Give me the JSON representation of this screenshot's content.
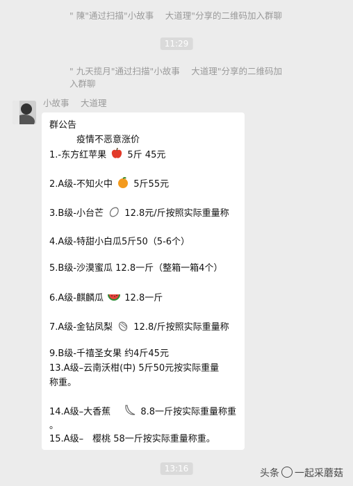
{
  "system_messages": [
    "\" 陳\"通过扫描\"小故事　 大道理\"分享的二维码加入群聊",
    "\" 九天揽月\"通过扫描\"小故事　 大道理\"分享的二维码加",
    "入群聊"
  ],
  "timestamps": [
    "11:29",
    "13:16"
  ],
  "sender_name": "小故事　 大道理",
  "announcement": {
    "lines": [
      "群公告",
      "　　　疫情不恶意涨价",
      "1.-东方红苹果",
      "5斤  45元",
      "2.A级-不知火中",
      "5斤55元",
      "3.B级-小台芒",
      "12.8元/斤按照实际重量称",
      "4.A级-特甜小白瓜5斤50（5-6个）",
      "5.B级-沙漠蜜瓜  12.8一斤（整箱一箱4个）",
      "6.A级-麒麟瓜",
      "12.8一斤",
      "7.A级-金钻凤梨",
      "12.8/斤按照实际重量称",
      "9.B级-千禧圣女果 约4斤45元",
      "13.A级–云南沃柑(中)  5斤50元按实际重量",
      "称重。",
      "14.A级–大香蕉　",
      "8.8一斤按实际重量称重",
      "。",
      "15.A级–　樱桃 58一斤按实际重量称重。"
    ]
  },
  "watermark": {
    "prefix": "头条",
    "handle": "一起采蘑菇"
  },
  "emoji_names": [
    "apple-emoji",
    "orange-emoji",
    "mango-emoji",
    "watermelon-emoji",
    "pineapple-emoji",
    "banana-emoji"
  ]
}
